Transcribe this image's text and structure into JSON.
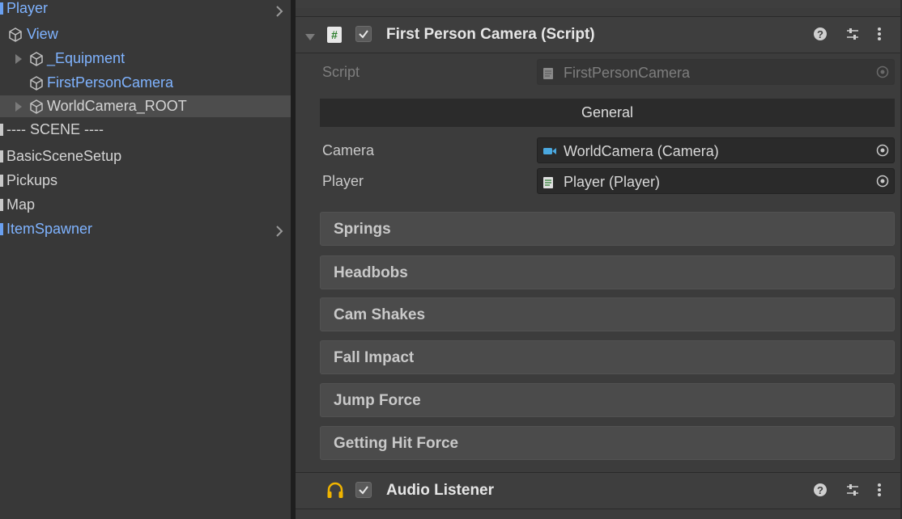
{
  "hierarchy": {
    "items": [
      {
        "label": "Player",
        "blue": true
      },
      {
        "label": "View",
        "blue": true
      },
      {
        "label": "_Equipment",
        "blue": true
      },
      {
        "label": "FirstPersonCamera",
        "blue": true
      },
      {
        "label": "WorldCamera_ROOT",
        "blue": false
      },
      {
        "label": "---- SCENE ----",
        "blue": false
      },
      {
        "label": "BasicSceneSetup",
        "blue": false
      },
      {
        "label": "Pickups",
        "blue": false
      },
      {
        "label": "Map",
        "blue": false
      },
      {
        "label": "ItemSpawner",
        "blue": true
      }
    ]
  },
  "inspector": {
    "component": {
      "title": "First Person Camera (Script)",
      "enabled": true,
      "script_label": "Script",
      "script_value": "FirstPersonCamera",
      "section_header": "General",
      "fields": [
        {
          "label": "Camera",
          "value": "WorldCamera (Camera)",
          "icon": "camera-icon"
        },
        {
          "label": "Player",
          "value": "Player (Player)",
          "icon": "script-asset-icon"
        }
      ],
      "foldouts": [
        "Springs",
        "Headbobs",
        "Cam Shakes",
        "Fall Impact",
        "Jump Force",
        "Getting Hit Force"
      ]
    },
    "audio_listener": {
      "title": "Audio Listener",
      "enabled": true
    }
  },
  "colors": {
    "blue_text": "#7fb3ff",
    "background": "#383838",
    "inspector_bg": "#3c3c3c"
  }
}
